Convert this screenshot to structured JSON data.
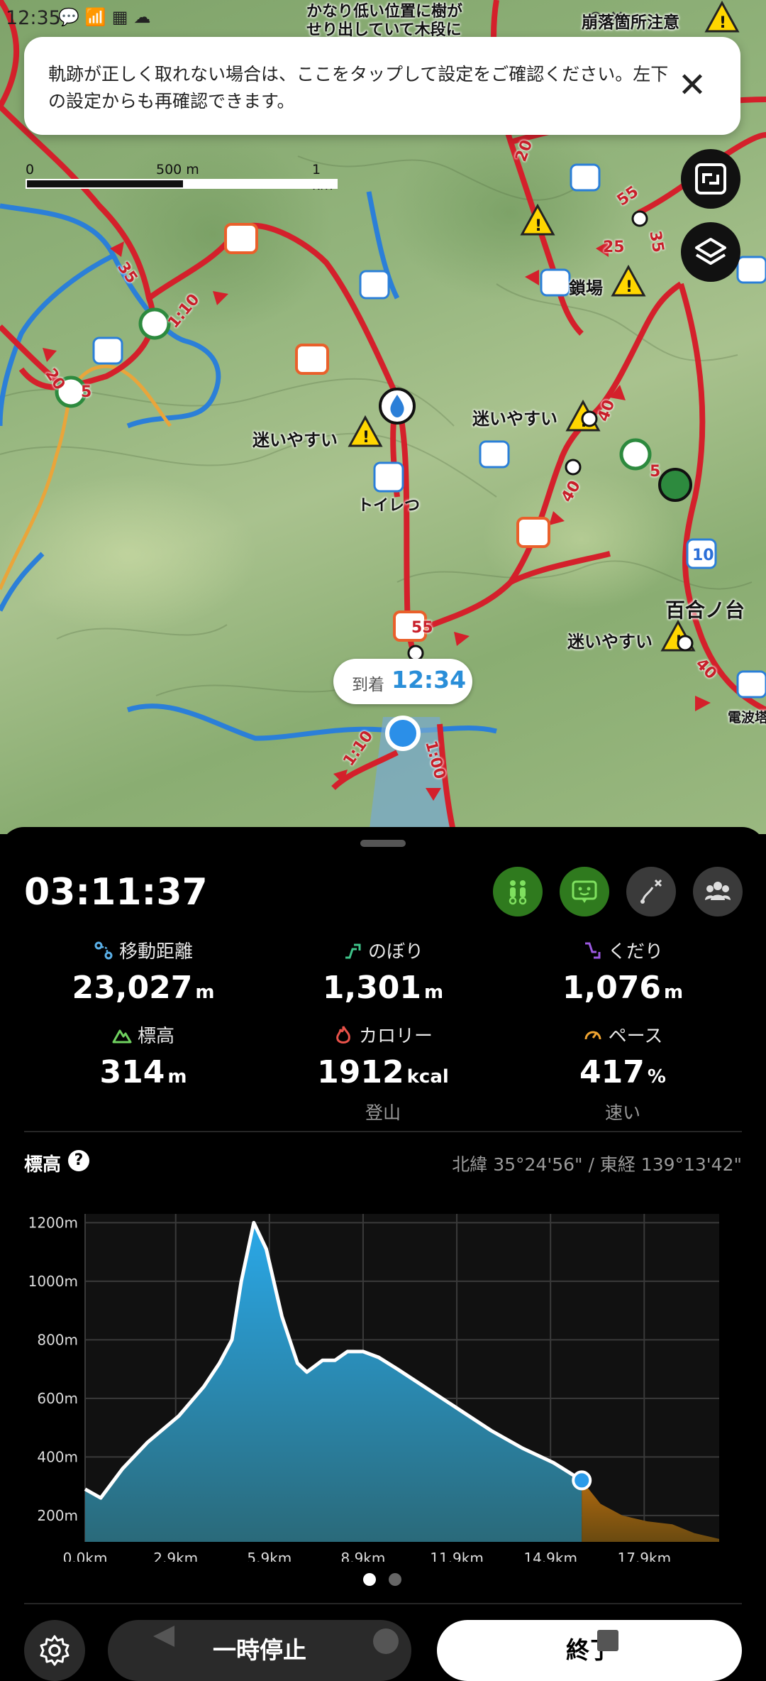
{
  "status_bar": {
    "time": "12:35",
    "icons": [
      "chat-icon",
      "signal-icon",
      "app-icon",
      "weather-icon"
    ],
    "right_icons": [
      "location-icon",
      "mute-icon",
      "battery-icon"
    ]
  },
  "banner": {
    "text": "軌跡が正しく取れない場合は、ここをタップして設定をご確認ください。左下の設定からも再確認できます。",
    "close_icon": "close-icon"
  },
  "map": {
    "scale": {
      "start": "0",
      "mid": "500 m",
      "end": "1 km"
    },
    "arrival": {
      "label": "到着",
      "time": "12:34"
    },
    "labels": {
      "top_warning": "かなり低い位置に樹が せり出していて木段に",
      "top_right": "崩落箇所注意",
      "lost1": "迷いやすい",
      "lost2": "迷いやすい",
      "lost3": "迷いやすい",
      "toilet": "トイレつ",
      "chain": "鎖場",
      "yuri": "百合ノ台",
      "radio": "電波塔"
    },
    "route_numbers": [
      "35",
      "1:10",
      "20",
      "5",
      "55",
      "20",
      "25",
      "35",
      "40",
      "40",
      "5",
      "10",
      "40",
      "55",
      "1:10",
      "1:00"
    ],
    "buttons": [
      {
        "name": "fullscreen-button",
        "icon": "fullscreen-icon"
      },
      {
        "name": "layers-button",
        "icon": "layers-icon"
      }
    ]
  },
  "panel": {
    "timer": "03:11:37",
    "top_icons": [
      "hikers-icon",
      "device-icon",
      "route-icon",
      "group-icon"
    ],
    "stats": [
      {
        "label": "移動距離",
        "value": "23,027",
        "unit": "m",
        "icon": "distance-icon",
        "color": "#5ab0e8"
      },
      {
        "label": "のぼり",
        "value": "1,301",
        "unit": "m",
        "icon": "ascent-icon",
        "color": "#3fc48a"
      },
      {
        "label": "くだり",
        "value": "1,076",
        "unit": "m",
        "icon": "descent-icon",
        "color": "#9b59e0"
      },
      {
        "label": "標高",
        "value": "314",
        "unit": "m",
        "icon": "mountain-icon",
        "color": "#6fd15f"
      },
      {
        "label": "カロリー",
        "value": "1912",
        "unit": "kcal",
        "icon": "flame-icon",
        "color": "#e8524a",
        "sub": "登山"
      },
      {
        "label": "ペース",
        "value": "417",
        "unit": "%",
        "icon": "speedometer-icon",
        "color": "#f0a431",
        "sub": "速い"
      }
    ],
    "elevation_title": "標高",
    "help_icon": "?",
    "coordinates": "北緯 35°24'56\" / 東経 139°13'42\"",
    "page_indicator": {
      "count": 2,
      "active": 0
    },
    "buttons": {
      "pause": "一時停止",
      "end": "終了"
    }
  },
  "chart_data": {
    "type": "area",
    "title": "標高",
    "xlabel": "",
    "ylabel": "",
    "x_tick_labels": [
      "0.0km",
      "2.9km",
      "5.9km",
      "8.9km",
      "11.9km",
      "14.9km",
      "17.9km"
    ],
    "y_tick_labels": [
      "200m",
      "400m",
      "600m",
      "800m",
      "1000m",
      "1200m"
    ],
    "xlim": [
      0,
      20.3
    ],
    "ylim": [
      110,
      1230
    ],
    "series": [
      {
        "x": [
          0,
          0.5,
          1.2,
          2.0,
          3.0,
          3.8,
          4.3,
          4.7,
          5.0,
          5.4,
          5.8,
          6.3,
          6.8,
          7.1,
          7.6,
          8.0,
          8.4,
          8.9,
          9.4,
          10.0,
          11.0,
          12.0,
          13.0,
          14.0,
          15.0,
          15.9
        ],
        "values": [
          290,
          260,
          360,
          450,
          540,
          640,
          720,
          800,
          1000,
          1200,
          1110,
          880,
          720,
          690,
          730,
          730,
          760,
          760,
          740,
          700,
          630,
          560,
          490,
          430,
          380,
          320
        ]
      },
      {
        "name": "",
        "x": [
          15.9,
          16.5,
          17.2,
          18.0,
          18.8,
          19.5,
          20.3
        ],
        "values": [
          320,
          240,
          200,
          180,
          170,
          140,
          120
        ]
      }
    ],
    "current_marker": {
      "x": 15.9,
      "value": 320
    },
    "grid": true
  }
}
